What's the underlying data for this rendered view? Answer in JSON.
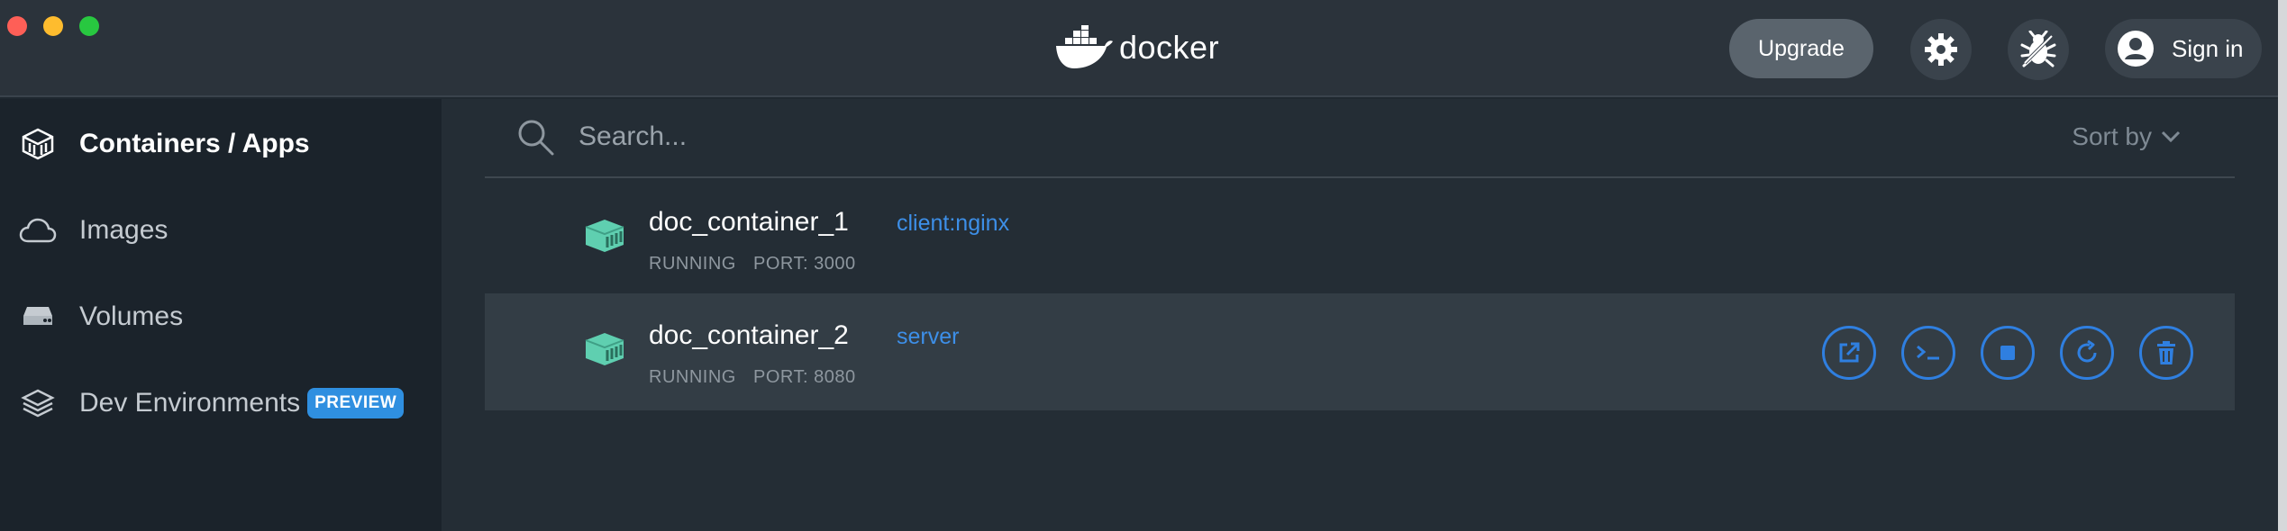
{
  "header": {
    "logo_text": "docker",
    "upgrade_label": "Upgrade",
    "signin_label": "Sign in",
    "icons": [
      "gear-icon",
      "bug-icon",
      "user-icon",
      "docker-whale-icon"
    ]
  },
  "sidebar": {
    "items": [
      {
        "label": "Containers / Apps",
        "icon": "containers-icon",
        "active": true
      },
      {
        "label": "Images",
        "icon": "cloud-icon",
        "active": false
      },
      {
        "label": "Volumes",
        "icon": "drive-icon",
        "active": false
      },
      {
        "label": "Dev Environments",
        "icon": "layers-icon",
        "active": false,
        "badge": "PREVIEW"
      }
    ]
  },
  "main": {
    "search": {
      "placeholder": "Search...",
      "value": ""
    },
    "sort_label": "Sort by",
    "containers": [
      {
        "name": "doc_container_1",
        "image": "client:nginx",
        "status": "RUNNING",
        "port": "PORT: 3000",
        "hovered": false
      },
      {
        "name": "doc_container_2",
        "image": "server",
        "status": "RUNNING",
        "port": "PORT: 8080",
        "hovered": true
      }
    ],
    "row_actions": [
      "open-in-browser-icon",
      "cli-icon",
      "stop-icon",
      "restart-icon",
      "delete-icon"
    ]
  },
  "colors": {
    "accent": "#2f7fe0",
    "container_icon": "#5fcfb0",
    "preview_badge": "#2f8fe0"
  }
}
